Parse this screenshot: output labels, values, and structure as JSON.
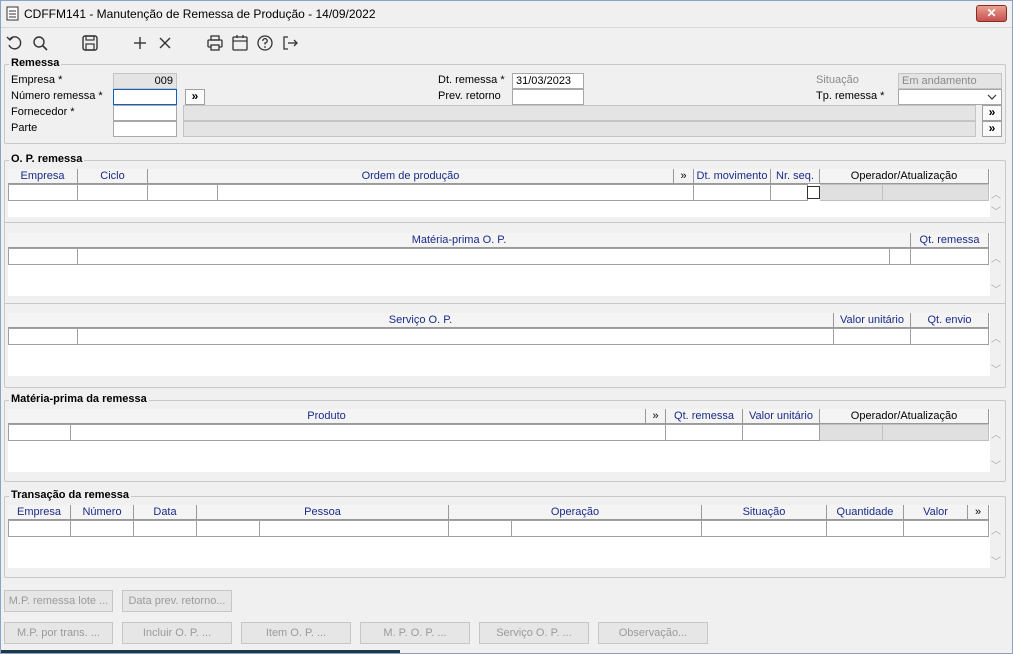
{
  "window": {
    "title": "CDFFM141 - Manutenção de Remessa de Produção - 14/09/2022",
    "close": "✕"
  },
  "toolbar": [
    "undo-icon",
    "search-icon",
    "save-icon",
    "add-icon",
    "delete-icon",
    "print-icon",
    "calendar-icon",
    "help-icon",
    "exit-icon"
  ],
  "remessa": {
    "title": "Remessa",
    "empresa_label": "Empresa *",
    "empresa_value": "009",
    "numero_label": "Número remessa *",
    "numero_value": "",
    "fornecedor_label": "Fornecedor *",
    "parte_label": "Parte",
    "dt_remessa_label": "Dt. remessa *",
    "dt_remessa_value": "31/03/2023",
    "prev_retorno_label": "Prev. retorno",
    "prev_retorno_value": "",
    "situacao_label": "Situação",
    "situacao_value": "Em andamento",
    "tp_remessa_label": "Tp. remessa *",
    "tp_remessa_value": "",
    "more": "»"
  },
  "op_remessa": {
    "title": "O. P. remessa",
    "headers": [
      "Empresa",
      "Ciclo",
      "Ordem de produção",
      "»",
      "Dt. movimento",
      "Nr. seq.",
      "Operador/Atualização"
    ]
  },
  "materia_op": {
    "headers": [
      "Matéria-prima O. P.",
      "Qt. remessa"
    ]
  },
  "servico_op": {
    "headers": [
      "Serviço O. P.",
      "Valor unitário",
      "Qt. envio"
    ]
  },
  "materia_remessa": {
    "title": "Matéria-prima da remessa",
    "headers": [
      "Produto",
      "»",
      "Qt. remessa",
      "Valor unitário",
      "Operador/Atualização"
    ]
  },
  "transacao": {
    "title": "Transação da remessa",
    "headers": [
      "Empresa",
      "Número",
      "Data",
      "Pessoa",
      "Operação",
      "Situação",
      "Quantidade",
      "Valor",
      "»"
    ]
  },
  "buttons": {
    "row1": [
      "M.P. remessa lote ...",
      "Data prev. retorno..."
    ],
    "row2": [
      "M.P. por trans. ...",
      "Incluir O. P. ...",
      "Item O. P. ...",
      "M. P. O. P. ...",
      "Serviço O. P. ...",
      "Observação..."
    ]
  },
  "scroll": {
    "up": "︿",
    "down": "﹀"
  }
}
